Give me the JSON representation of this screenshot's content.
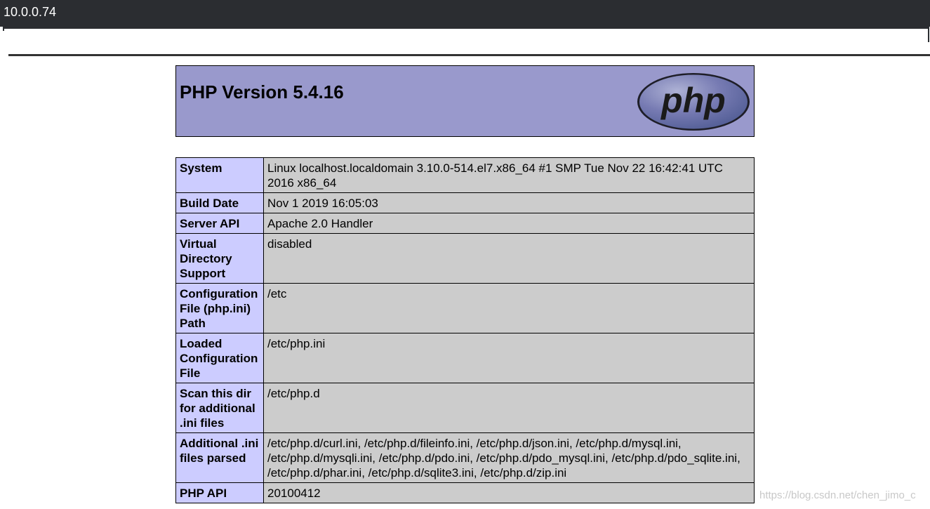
{
  "window": {
    "title": "10.0.0.74"
  },
  "header": {
    "title": "PHP Version 5.4.16",
    "logo_text": "php",
    "logo_icon": "php-logo-icon"
  },
  "info_table": {
    "rows": [
      {
        "key": "System",
        "value": "Linux localhost.localdomain 3.10.0-514.el7.x86_64 #1 SMP Tue Nov 22 16:42:41 UTC 2016 x86_64"
      },
      {
        "key": "Build Date",
        "value": "Nov 1 2019 16:05:03"
      },
      {
        "key": "Server API",
        "value": "Apache 2.0 Handler"
      },
      {
        "key": "Virtual Directory Support",
        "value": "disabled"
      },
      {
        "key": "Configuration File (php.ini) Path",
        "value": "/etc"
      },
      {
        "key": "Loaded Configuration File",
        "value": "/etc/php.ini"
      },
      {
        "key": "Scan this dir for additional .ini files",
        "value": "/etc/php.d"
      },
      {
        "key": "Additional .ini files parsed",
        "value": "/etc/php.d/curl.ini, /etc/php.d/fileinfo.ini, /etc/php.d/json.ini, /etc/php.d/mysql.ini, /etc/php.d/mysqli.ini, /etc/php.d/pdo.ini, /etc/php.d/pdo_mysql.ini, /etc/php.d/pdo_sqlite.ini, /etc/php.d/phar.ini, /etc/php.d/sqlite3.ini, /etc/php.d/zip.ini"
      },
      {
        "key": "PHP API",
        "value": "20100412"
      }
    ]
  },
  "watermark": "https://blog.csdn.net/chen_jimo_c",
  "colors": {
    "header_bg": "#9999cc",
    "key_bg": "#ccccff",
    "value_bg": "#cccccc",
    "topbar_bg": "#2b2d31"
  }
}
